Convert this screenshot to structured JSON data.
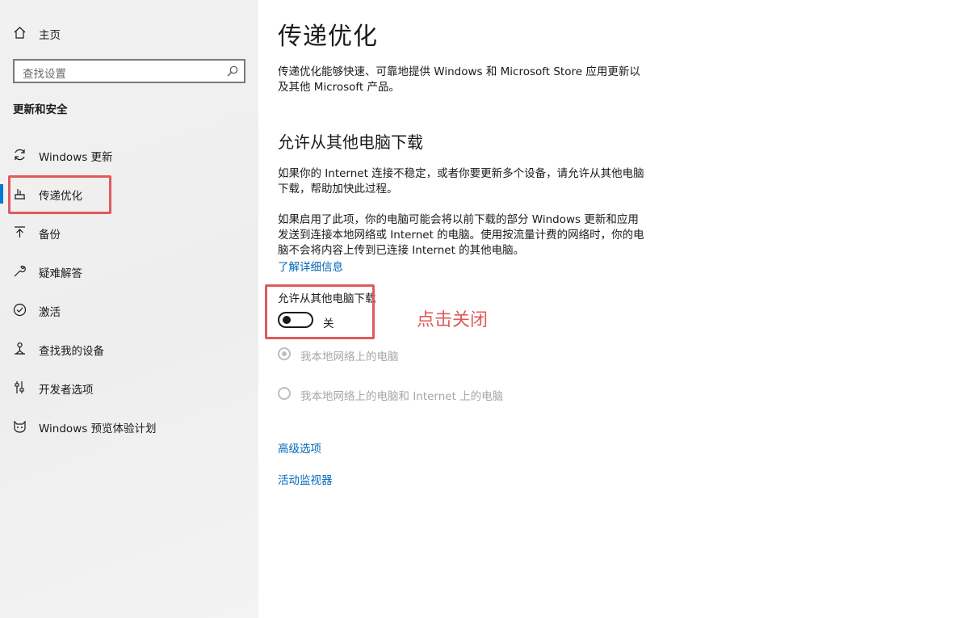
{
  "sidebar": {
    "home_label": "主页",
    "search_placeholder": "查找设置",
    "section_title": "更新和安全",
    "items": [
      {
        "label": "Windows 更新",
        "icon": "sync-icon"
      },
      {
        "label": "传递优化",
        "icon": "delivery-optimization-icon"
      },
      {
        "label": "备份",
        "icon": "backup-icon"
      },
      {
        "label": "疑难解答",
        "icon": "wrench-icon"
      },
      {
        "label": "激活",
        "icon": "activation-check-icon"
      },
      {
        "label": "查找我的设备",
        "icon": "find-device-icon"
      },
      {
        "label": "开发者选项",
        "icon": "developer-sliders-icon"
      },
      {
        "label": "Windows 预览体验计划",
        "icon": "insider-cat-icon"
      }
    ],
    "active_index": 1
  },
  "main": {
    "title": "传递优化",
    "intro": "传递优化能够快速、可靠地提供 Windows 和 Microsoft Store 应用更新以及其他 Microsoft 产品。",
    "subtitle": "允许从其他电脑下载",
    "para1": "如果你的 Internet 连接不稳定，或者你要更新多个设备，请允许从其他电脑下载，帮助加快此过程。",
    "para2": "如果启用了此项，你的电脑可能会将以前下载的部分 Windows 更新和应用发送到连接本地网络或 Internet 的电脑。使用按流量计费的网络时，你的电脑不会将内容上传到已连接 Internet 的其他电脑。",
    "learn_more": "了解详细信息",
    "toggle_label": "允许从其他电脑下载",
    "toggle_state": "关",
    "toggle_on": false,
    "radio_options": [
      {
        "label": "我本地网络上的电脑",
        "selected": true,
        "enabled": false
      },
      {
        "label": "我本地网络上的电脑和 Internet 上的电脑",
        "selected": false,
        "enabled": false
      }
    ],
    "advanced_link": "高级选项",
    "monitor_link": "活动监视器"
  },
  "annotations": {
    "click_text": "点击关闭",
    "box_color": "#e05a5a"
  },
  "colors": {
    "accent": "#0078d4",
    "link": "#0067b8"
  }
}
